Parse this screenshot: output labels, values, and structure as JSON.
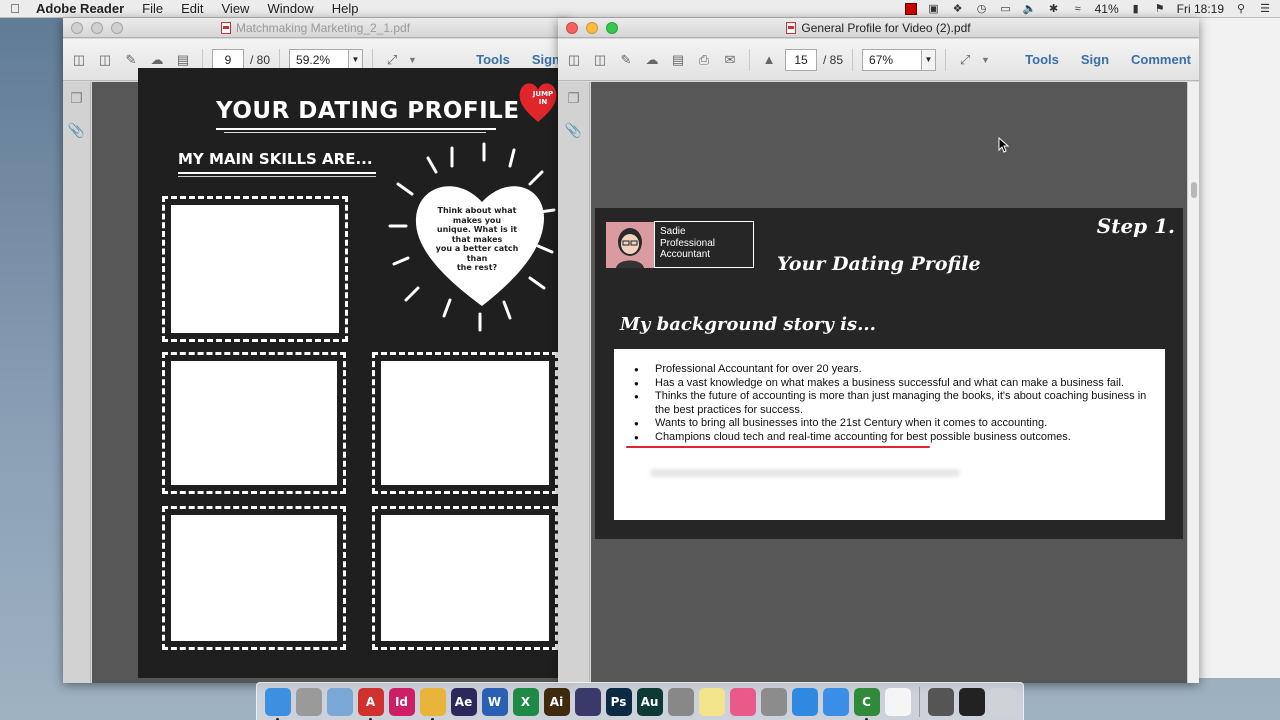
{
  "menubar": {
    "app_name": "Adobe Reader",
    "menus": [
      "File",
      "Edit",
      "View",
      "Window",
      "Help"
    ],
    "battery": "41%",
    "clock": "Fri 18:19"
  },
  "left_window": {
    "title": "Matchmaking Marketing_2_1.pdf",
    "page": "9",
    "total_pages": "/ 80",
    "zoom": "59.2%",
    "tools_label": "Tools",
    "sign_label": "Sign"
  },
  "right_window": {
    "title": "General Profile for Video (2).pdf",
    "page": "15",
    "total_pages": "/ 85",
    "zoom": "67%",
    "tools_label": "Tools",
    "sign_label": "Sign",
    "comment_label": "Comment"
  },
  "left_doc": {
    "title": "YOUR DATING PROFILE",
    "subtitle": "MY MAIN SKILLS ARE...",
    "jump_badge": "JUMP IN",
    "heart_lines": [
      "Think about what",
      "makes you",
      "unique. What is it",
      "that makes",
      "you a better catch",
      "than",
      "the rest?"
    ]
  },
  "right_doc": {
    "step": "Step 1.",
    "name_lines": [
      "Sadie",
      "Professional",
      "Accountant"
    ],
    "title": "Your Dating Profile",
    "story_title": "My background story is...",
    "bullets": [
      "Professional Accountant for over 20 years.",
      "Has a vast knowledge on what makes a business successful and what can make a business fail.",
      "Thinks the future of accounting is more than just managing the books, it's about coaching business in the best practices for success.",
      "Wants to bring all businesses into the 21st Century when it comes to accounting.",
      "Champions cloud tech and real-time accounting for best possible business outcomes."
    ]
  },
  "colors": {
    "link_blue": "#3b6fa8",
    "accent_red": "#e0262b",
    "doc_dark": "#262626",
    "chalkboard": "#1f1f1f"
  },
  "dock": {
    "apps": [
      {
        "name": "finder",
        "label": "",
        "color": "#3d8fe0"
      },
      {
        "name": "notes",
        "label": "",
        "color": "#9a9a9a"
      },
      {
        "name": "preview",
        "label": "",
        "color": "#7aa7d6"
      },
      {
        "name": "acrobat",
        "label": "A",
        "color": "#d0312d"
      },
      {
        "name": "indesign",
        "label": "Id",
        "color": "#cc1f66"
      },
      {
        "name": "chrome",
        "label": "",
        "color": "#e8b43a"
      },
      {
        "name": "after-effects",
        "label": "Ae",
        "color": "#2a2a5a"
      },
      {
        "name": "word",
        "label": "W",
        "color": "#2b5fb4"
      },
      {
        "name": "excel",
        "label": "X",
        "color": "#1f8a46"
      },
      {
        "name": "illustrator",
        "label": "Ai",
        "color": "#402a0e"
      },
      {
        "name": "quicktime",
        "label": "",
        "color": "#3a3a6a"
      },
      {
        "name": "photoshop",
        "label": "Ps",
        "color": "#0d2a45"
      },
      {
        "name": "audition",
        "label": "Au",
        "color": "#0e3a35"
      },
      {
        "name": "pen-tool",
        "label": "",
        "color": "#888888"
      },
      {
        "name": "stickies",
        "label": "",
        "color": "#f2e48a"
      },
      {
        "name": "itunes",
        "label": "",
        "color": "#e85a8a"
      },
      {
        "name": "system-preferences",
        "label": "",
        "color": "#8c8c8c"
      },
      {
        "name": "app-store",
        "label": "",
        "color": "#2f89e0"
      },
      {
        "name": "safari",
        "label": "",
        "color": "#3a8ee6"
      },
      {
        "name": "camtasia",
        "label": "C",
        "color": "#2f8a3a"
      },
      {
        "name": "calendar",
        "label": "",
        "color": "#f5f5f5"
      },
      {
        "name": "printer",
        "label": "",
        "color": "#555555"
      },
      {
        "name": "terminal",
        "label": "",
        "color": "#222222"
      },
      {
        "name": "trash",
        "label": "",
        "color": "#cfd3d8"
      }
    ]
  }
}
